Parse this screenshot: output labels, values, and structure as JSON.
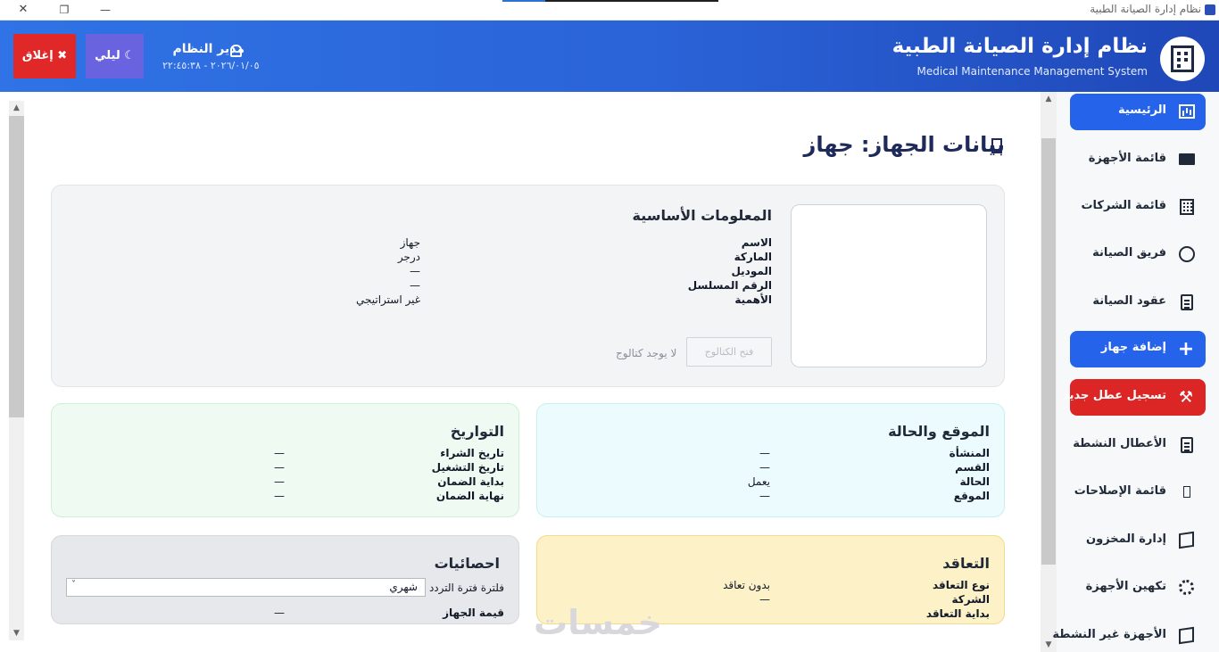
{
  "window": {
    "title": "نظام إدارة الصيانة الطبية",
    "close_glyph": "✕",
    "maximize_glyph": "❐",
    "minimize_glyph": "—"
  },
  "header": {
    "title": "نظام إدارة الصيانة الطبية",
    "subtitle": "Medical Maintenance Management System",
    "logo_icon": "hospital-building-icon",
    "user_name": "مدير النظام",
    "datetime": "٢٠٢٦/٠١/٠٥ - ٢٢:٤٥:٣٨",
    "night_label": "ليلي",
    "night_glyph": "☾",
    "close_label": "إغلاق",
    "close_glyph": "✖"
  },
  "sidebar": {
    "items": [
      {
        "label": "الرئيسية",
        "icon": "chart-icon",
        "style": "active"
      },
      {
        "label": "قائمة الأجهزة",
        "icon": "monitor-icon",
        "style": "normal"
      },
      {
        "label": "قائمة الشركات",
        "icon": "building-icon",
        "style": "normal"
      },
      {
        "label": "فريق الصيانة",
        "icon": "technician-icon",
        "style": "normal"
      },
      {
        "label": "عقود الصيانة",
        "icon": "clipboard-icon",
        "style": "normal"
      },
      {
        "label": "إضافة جهاز",
        "icon": "plus-icon",
        "style": "active"
      },
      {
        "label": "تسجيل عطل جديد",
        "icon": "tools-icon",
        "style": "red"
      },
      {
        "label": "الأعطال النشطة",
        "icon": "clipboard-list-icon",
        "style": "normal"
      },
      {
        "label": "قائمة الإصلاحات",
        "icon": "phone-icon",
        "style": "normal"
      },
      {
        "label": "إدارة المخزون",
        "icon": "box-icon",
        "style": "normal"
      },
      {
        "label": "تكهين الأجهزة",
        "icon": "gear-icon",
        "style": "normal"
      },
      {
        "label": "الأجهزة غير النشطة",
        "icon": "box-icon",
        "style": "normal"
      }
    ],
    "plus_glyph": "+",
    "tools_glyph": "⚒"
  },
  "page": {
    "title": "بيانات الجهاز: جهاز"
  },
  "basic_info": {
    "title": "المعلومات الأساسية",
    "rows": [
      {
        "label": "الاسم",
        "value": "جهاز"
      },
      {
        "label": "الماركة",
        "value": "درجر"
      },
      {
        "label": "الموديل",
        "value": "—"
      },
      {
        "label": "الرقم المسلسل",
        "value": "—"
      },
      {
        "label": "الأهمية",
        "value": "غير استراتيجي"
      }
    ],
    "catalog_button": "فتح الكتالوج",
    "no_catalog": "لا يوجد كتالوج"
  },
  "location": {
    "title": "الموقع والحالة",
    "rows": [
      {
        "label": "المنشأة",
        "value": "—"
      },
      {
        "label": "القسم",
        "value": "—"
      },
      {
        "label": "الحالة",
        "value": "يعمل"
      },
      {
        "label": "الموقع",
        "value": "—"
      }
    ]
  },
  "dates": {
    "title": "التواريخ",
    "rows": [
      {
        "label": "تاريخ الشراء",
        "value": "—"
      },
      {
        "label": "تاريخ التشغيل",
        "value": "—"
      },
      {
        "label": "بداية الضمان",
        "value": "—"
      },
      {
        "label": "نهاية الضمان",
        "value": "—"
      }
    ]
  },
  "contract": {
    "title": "التعاقد",
    "rows": [
      {
        "label": "نوع التعاقد",
        "value": "بدون تعاقد"
      },
      {
        "label": "الشركة",
        "value": "—"
      },
      {
        "label": "بداية التعاقد",
        "value": ""
      }
    ]
  },
  "stats": {
    "title": "احصائيات",
    "freq_label": "فلترة فترة التردد",
    "freq_value": "شهري",
    "rows": [
      {
        "label": "قيمة الجهاز",
        "value": "—"
      }
    ]
  },
  "watermark": "خمسات",
  "scroll": {
    "up": "▲",
    "down": "▼"
  }
}
